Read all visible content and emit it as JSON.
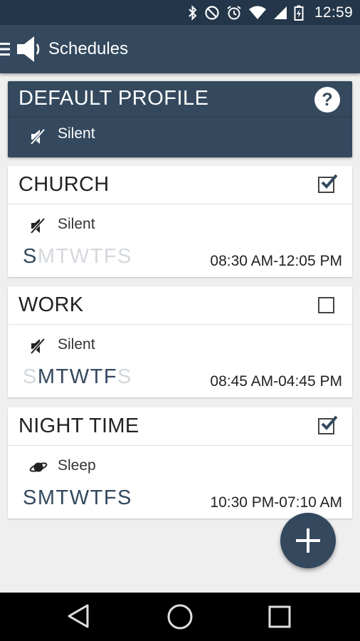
{
  "status_bar": {
    "time": "12:59",
    "icons": [
      "bluetooth-icon",
      "do-not-disturb-icon",
      "alarm-icon",
      "wifi-icon",
      "signal-icon",
      "battery-charging-icon"
    ]
  },
  "app_bar": {
    "title": "Schedules",
    "icons": [
      "menu-icon",
      "speaker-icon"
    ]
  },
  "default_profile": {
    "title": "DEFAULT PROFILE",
    "help_label": "?",
    "mode": "Silent",
    "mode_icon": "muted-speaker-icon"
  },
  "schedules": [
    {
      "name": "CHURCH",
      "checked": true,
      "mode": "Silent",
      "mode_icon": "muted-speaker-icon",
      "days": [
        {
          "letter": "S",
          "active": true
        },
        {
          "letter": "M",
          "active": false
        },
        {
          "letter": "T",
          "active": false
        },
        {
          "letter": "W",
          "active": false
        },
        {
          "letter": "T",
          "active": false
        },
        {
          "letter": "F",
          "active": false
        },
        {
          "letter": "S",
          "active": false
        }
      ],
      "time_range": "08:30 AM-12:05 PM"
    },
    {
      "name": "WORK",
      "checked": false,
      "mode": "Silent",
      "mode_icon": "muted-speaker-icon",
      "days": [
        {
          "letter": "S",
          "active": false
        },
        {
          "letter": "M",
          "active": true
        },
        {
          "letter": "T",
          "active": true
        },
        {
          "letter": "W",
          "active": true
        },
        {
          "letter": "T",
          "active": true
        },
        {
          "letter": "F",
          "active": true
        },
        {
          "letter": "S",
          "active": false
        }
      ],
      "time_range": "08:45 AM-04:45 PM"
    },
    {
      "name": "NIGHT TIME",
      "checked": true,
      "mode": "Sleep",
      "mode_icon": "planet-icon",
      "days": [
        {
          "letter": "S",
          "active": true
        },
        {
          "letter": "M",
          "active": true
        },
        {
          "letter": "T",
          "active": true
        },
        {
          "letter": "W",
          "active": true
        },
        {
          "letter": "T",
          "active": true
        },
        {
          "letter": "F",
          "active": true
        },
        {
          "letter": "S",
          "active": true
        }
      ],
      "time_range": "10:30 PM-07:10 AM"
    }
  ],
  "fab": {
    "icon": "plus-icon"
  },
  "nav_bar": {
    "icons": [
      "back-icon",
      "home-icon",
      "recent-apps-icon"
    ]
  },
  "colors": {
    "primary": "#34495e",
    "status_bar": "#243649",
    "background": "#efefef",
    "day_active": "#34495e",
    "day_inactive": "#d4d8dc"
  }
}
